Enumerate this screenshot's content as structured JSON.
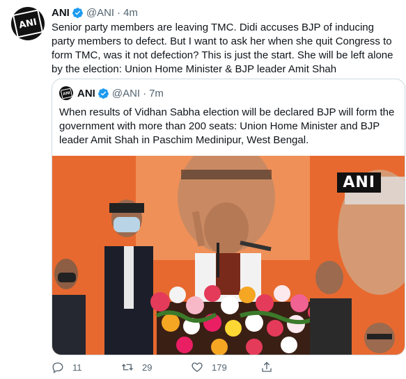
{
  "tweet": {
    "display_name": "ANI",
    "handle": "@ANI",
    "time": "4m",
    "avatar_text": "ANI",
    "text": "Senior party members are leaving TMC. Didi accuses BJP of inducing party members to defect. But I want to ask her when she quit Congress to form TMC, was it not defection? This is just the start. She will be left alone by the election: Union Home Minister & BJP leader Amit Shah"
  },
  "quoted_tweet": {
    "display_name": "ANI",
    "handle": "@ANI",
    "time": "7m",
    "avatar_text": "ANI",
    "text": "When results of Vidhan Sabha election will be declared BJP will form the government with more than 200 seats: Union Home Minister and BJP leader Amit Shah in Paschim Medinipur, West Bengal.",
    "media": {
      "watermark": "ANI"
    }
  },
  "actions": {
    "replies": "11",
    "retweets": "29",
    "likes": "179"
  },
  "colors": {
    "verified": "#1d9bf0",
    "text": "#0f1419",
    "muted": "#536471"
  }
}
